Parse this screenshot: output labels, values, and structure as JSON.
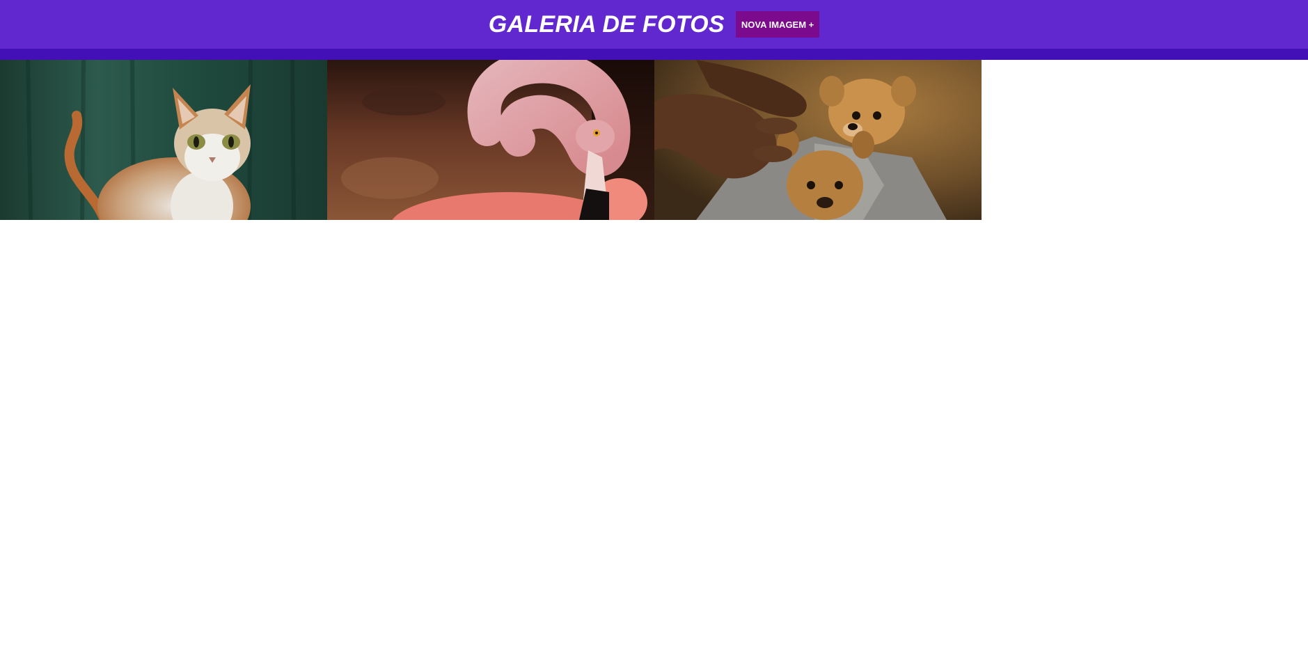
{
  "header": {
    "title": "GALERIA DE FOTOS",
    "new_image_button": "NOVA IMAGEM +"
  },
  "colors": {
    "header_bg": "#6128cf",
    "header_bar": "#4310b8",
    "button_bg": "#7c0a8d"
  },
  "gallery": {
    "photos": [
      {
        "subject": "cat-painting"
      },
      {
        "subject": "flamingo"
      },
      {
        "subject": "puppies-in-towel"
      }
    ]
  }
}
